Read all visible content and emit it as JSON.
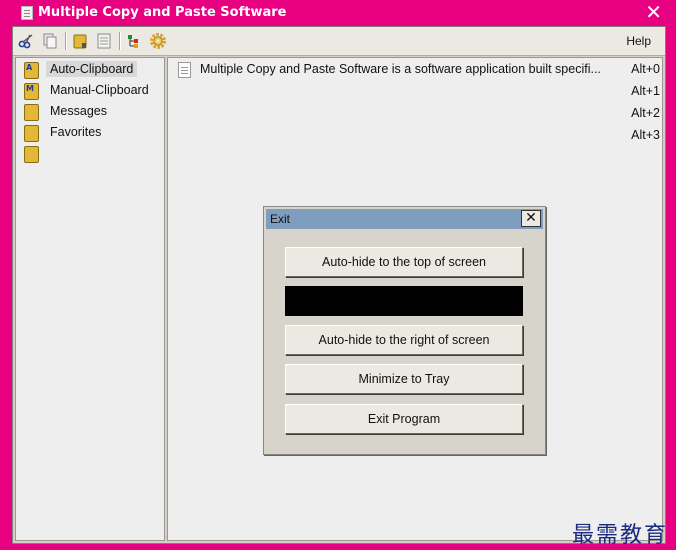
{
  "window": {
    "title": "Multiple Copy and Paste Software",
    "close_glyph": "✕"
  },
  "toolbar": {
    "icons": [
      "scissors-icon",
      "copy-icon",
      "folder-icon",
      "document-icon",
      "tree-icon",
      "settings-gear-icon"
    ],
    "help_label": "Help"
  },
  "sidebar": {
    "items": [
      {
        "label": "Auto-Clipboard",
        "letter": "A",
        "selected": true
      },
      {
        "label": "Manual-Clipboard",
        "letter": "M",
        "selected": false
      },
      {
        "label": "Messages",
        "letter": "",
        "selected": false
      },
      {
        "label": "Favorites",
        "letter": "",
        "selected": false
      },
      {
        "label": "",
        "letter": "",
        "selected": false
      }
    ]
  },
  "clips": [
    {
      "text": "Multiple Copy and Paste Software is a software application built specifi...",
      "hotkey": "Alt+0"
    },
    {
      "text": "",
      "hotkey": "Alt+1"
    },
    {
      "text": "",
      "hotkey": "Alt+2"
    },
    {
      "text": "",
      "hotkey": "Alt+3"
    }
  ],
  "exit_dialog": {
    "title": "Exit",
    "close_glyph": "✕",
    "buttons": {
      "hide_top": "Auto-hide to the top of screen",
      "hide_right": "Auto-hide to the right of screen",
      "minimize_tray": "Minimize to Tray",
      "exit_program": "Exit Program"
    }
  },
  "watermark": "最需教育",
  "colors": {
    "titlebar": "#e7007f",
    "dialog_title": "#7f9ebf",
    "folder": "#e1b838"
  }
}
